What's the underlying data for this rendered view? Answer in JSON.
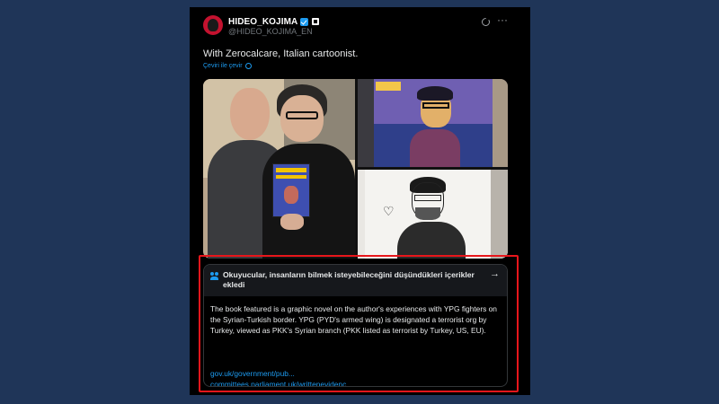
{
  "post": {
    "display_name": "HIDEO_KOJIMA",
    "handle": "@HIDEO_KOJIMA_EN",
    "text": "With Zerocalcare, Italian cartoonist.",
    "translate_label": "Çeviri ile çevir",
    "avatar_icon": "avatar-icon",
    "verified_icon": "verified-badge-icon",
    "affiliate_icon": "affiliate-badge-icon",
    "grok_icon": "grok-icon",
    "more_icon": "more-icon"
  },
  "media": {
    "images": [
      {
        "name": "photo-kojima-zerocalcare"
      },
      {
        "name": "photo-comic-page"
      },
      {
        "name": "photo-sketch"
      }
    ],
    "book_title": "KOBANE CALLING"
  },
  "community_note": {
    "title": "Okuyucular, insanların bilmek isteyebileceğini düşündükleri içerikler ekledi",
    "body": "The book featured is a graphic novel on the author's experiences with YPG fighters on the Syrian-Turkish border. YPG (PYD's armed wing) is designated a terrorist org by Turkey, viewed as PKK's Syrian branch (PKK listed as terrorist by Turkey, US, EU).",
    "links": [
      "gov.uk/government/pub...",
      "committees.parliament.uk/writtenevidenc..."
    ],
    "arrow_icon": "arrow-right-icon",
    "people_icon": "people-icon"
  },
  "colors": {
    "page_background": "#1f3558",
    "card_background": "#000000",
    "accent": "#1d9bf0",
    "highlight_border": "#e8161b"
  }
}
